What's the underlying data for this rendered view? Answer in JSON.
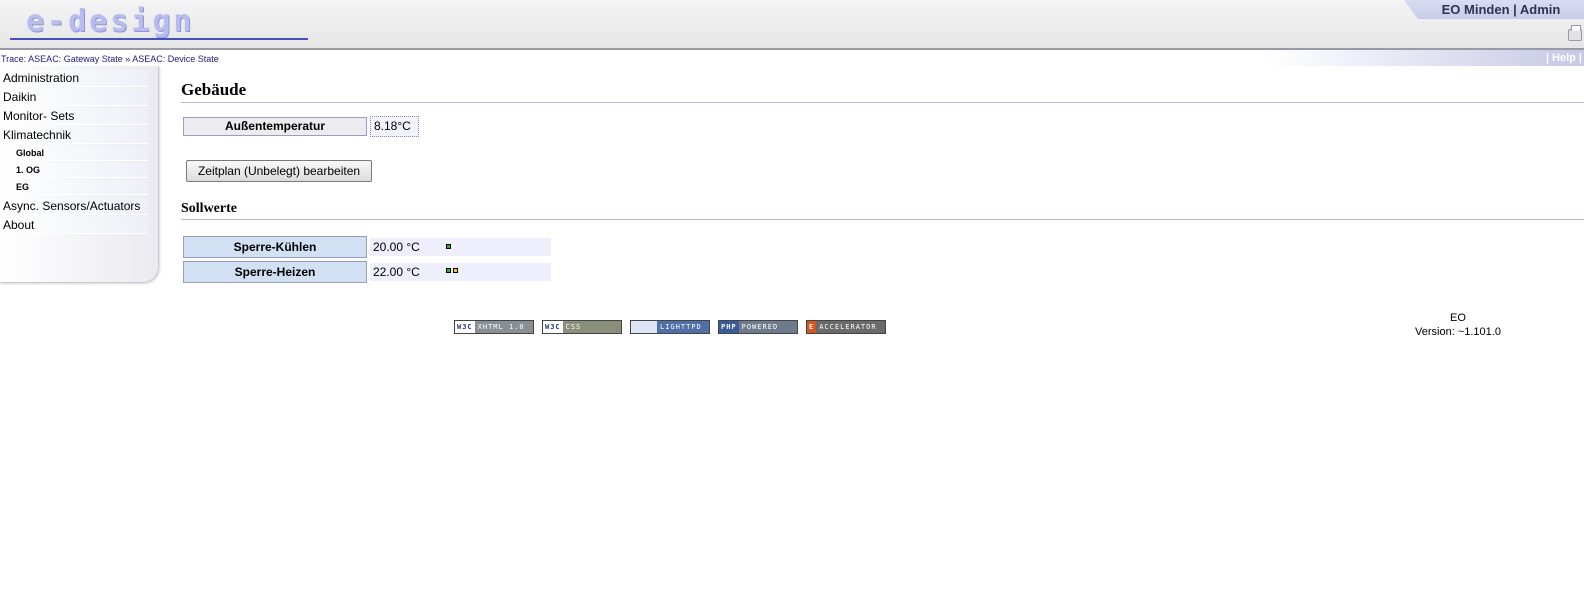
{
  "header": {
    "logo_text": "e-design",
    "user_info": "EO Minden | Admin"
  },
  "trace": {
    "text": "Trace: ASEAC: Gateway State » ASEAC: Device State",
    "help": "| Help |"
  },
  "sidebar": {
    "items": [
      {
        "label": "Administration"
      },
      {
        "label": "Daikin"
      },
      {
        "label": "Monitor- Sets"
      },
      {
        "label": "Klimatechnik"
      },
      {
        "label": "Global"
      },
      {
        "label": "1. OG"
      },
      {
        "label": "EG"
      },
      {
        "label": "Async. Sensors/Actuators"
      },
      {
        "label": "About"
      }
    ]
  },
  "building": {
    "title": "Gebäude",
    "outdoor_label": "Außentemperatur",
    "outdoor_value": "8.18°C",
    "schedule_button": "Zeitplan (Unbelegt) bearbeiten"
  },
  "setpoints": {
    "title": "Sollwerte",
    "rows": [
      {
        "label": "Sperre-Kühlen",
        "value": "20.00 °C"
      },
      {
        "label": "Sperre-Heizen",
        "value": "22.00 °C"
      }
    ]
  },
  "footer": {
    "badges": [
      {
        "left": "W3C",
        "right": "XHTML 1.0"
      },
      {
        "left": "W3C",
        "right": "CSS"
      },
      {
        "left": "",
        "right": "LIGHTTPD"
      },
      {
        "left": "PHP",
        "right": "POWERED"
      },
      {
        "left": "E",
        "right": "ACCELERATOR"
      }
    ],
    "product": "EO",
    "version": "Version: ~1.101.0"
  },
  "colors": {
    "accent": "#c9cce8",
    "led_green": "#30b030",
    "led_yellow": "#e8d020"
  }
}
